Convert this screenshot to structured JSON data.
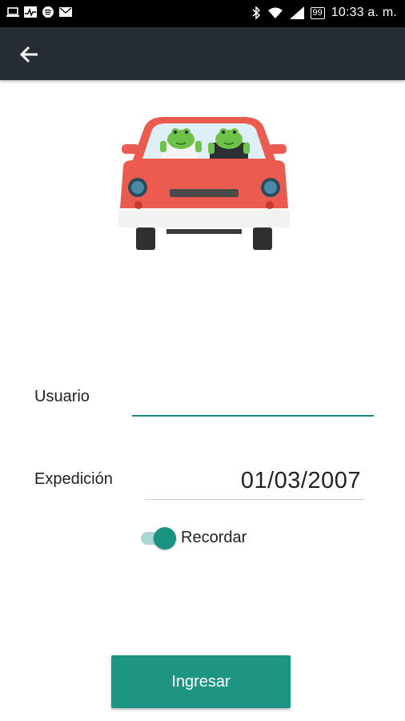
{
  "status_bar": {
    "battery": "99",
    "time": "10:33 a. m.",
    "left_icons": [
      "laptop-icon",
      "activity-icon",
      "spotify-icon",
      "mail-icon"
    ],
    "right_icons": [
      "bluetooth-icon",
      "wifi-icon",
      "signal-icon",
      "battery-icon"
    ]
  },
  "app_bar": {
    "back_icon": "arrow-back-icon",
    "background": "#262c33"
  },
  "hero": {
    "image": "red-car-with-frogs-illustration"
  },
  "form": {
    "user_label": "Usuario",
    "user_value": "",
    "expedition_label": "Expedición",
    "expedition_value": "01/03/2007",
    "remember_label": "Recordar",
    "remember_on": true
  },
  "login_button": {
    "label": "Ingresar"
  },
  "colors": {
    "accent": "#1e9583",
    "switch_track": "#a8d8d1",
    "car": "#ec5b4f"
  }
}
